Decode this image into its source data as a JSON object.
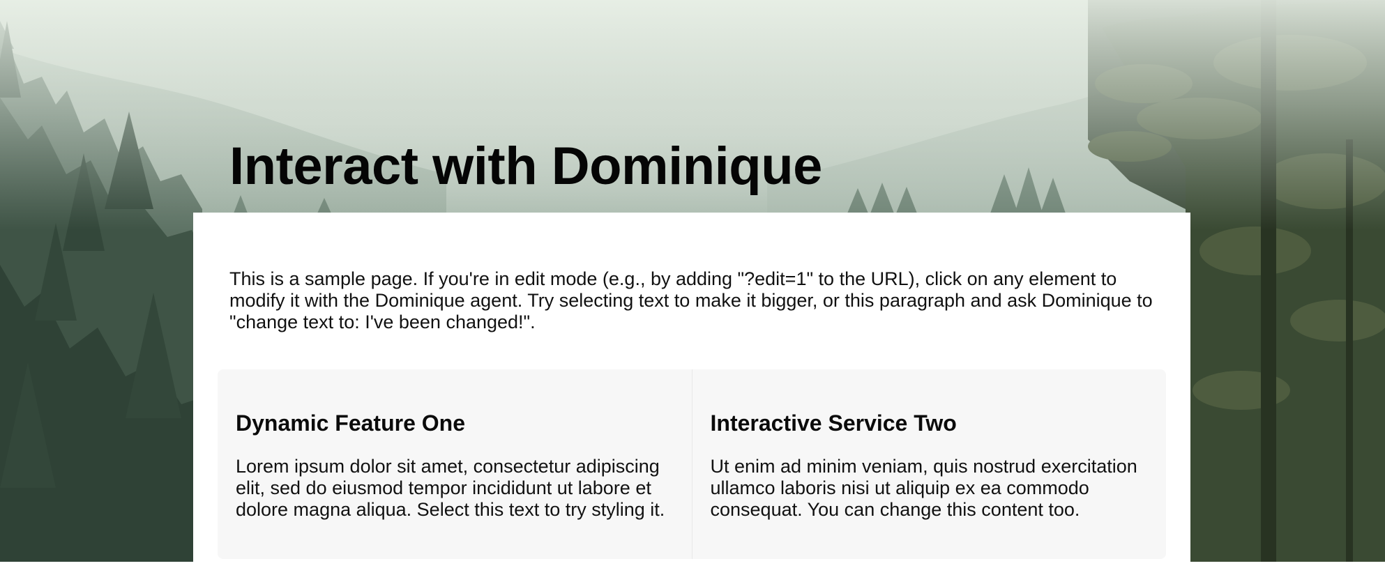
{
  "page": {
    "title": "Interact with Dominique",
    "intro": "This is a sample page. If you're in edit mode (e.g., by adding \"?edit=1\" to the URL), click on any element to modify it with the Dominique agent. Try selecting text to make it bigger, or this paragraph and ask Dominique to \"change text to: I've been changed!\"."
  },
  "features": [
    {
      "title": "Dynamic Feature One",
      "text": "Lorem ipsum dolor sit amet, consectetur adipiscing elit, sed do eiusmod tempor incididunt ut labore et dolore magna aliqua. Select this text to try styling it."
    },
    {
      "title": "Interactive Service Two",
      "text": "Ut enim ad minim veniam, quis nostrud exercitation ullamco laboris nisi ut aliquip ex ea commodo consequat. You can change this content too."
    }
  ],
  "colors": {
    "card_background": "#ffffff",
    "panel_background": "#f7f7f7",
    "text": "#111111"
  }
}
